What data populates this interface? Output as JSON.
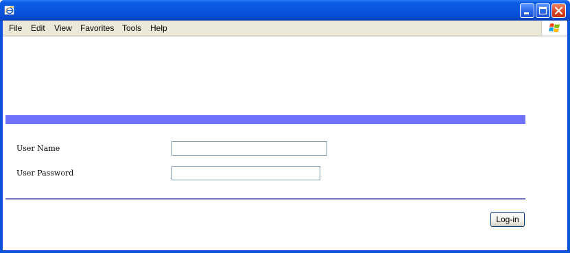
{
  "window": {
    "title": "",
    "app_icon": "ie-icon",
    "controls": [
      "minimize-icon",
      "maximize-icon",
      "close-icon"
    ]
  },
  "menu": {
    "items": [
      "File",
      "Edit",
      "View",
      "Favorites",
      "Tools",
      "Help"
    ],
    "brand_icon": "windows-logo-icon"
  },
  "form": {
    "banner_color": "#7070ff",
    "divider_color": "#6f74c4",
    "user_name_label": "User Name",
    "user_name_value": "",
    "user_password_label": "User Password",
    "user_password_value": "",
    "login_label": "Log-in"
  }
}
